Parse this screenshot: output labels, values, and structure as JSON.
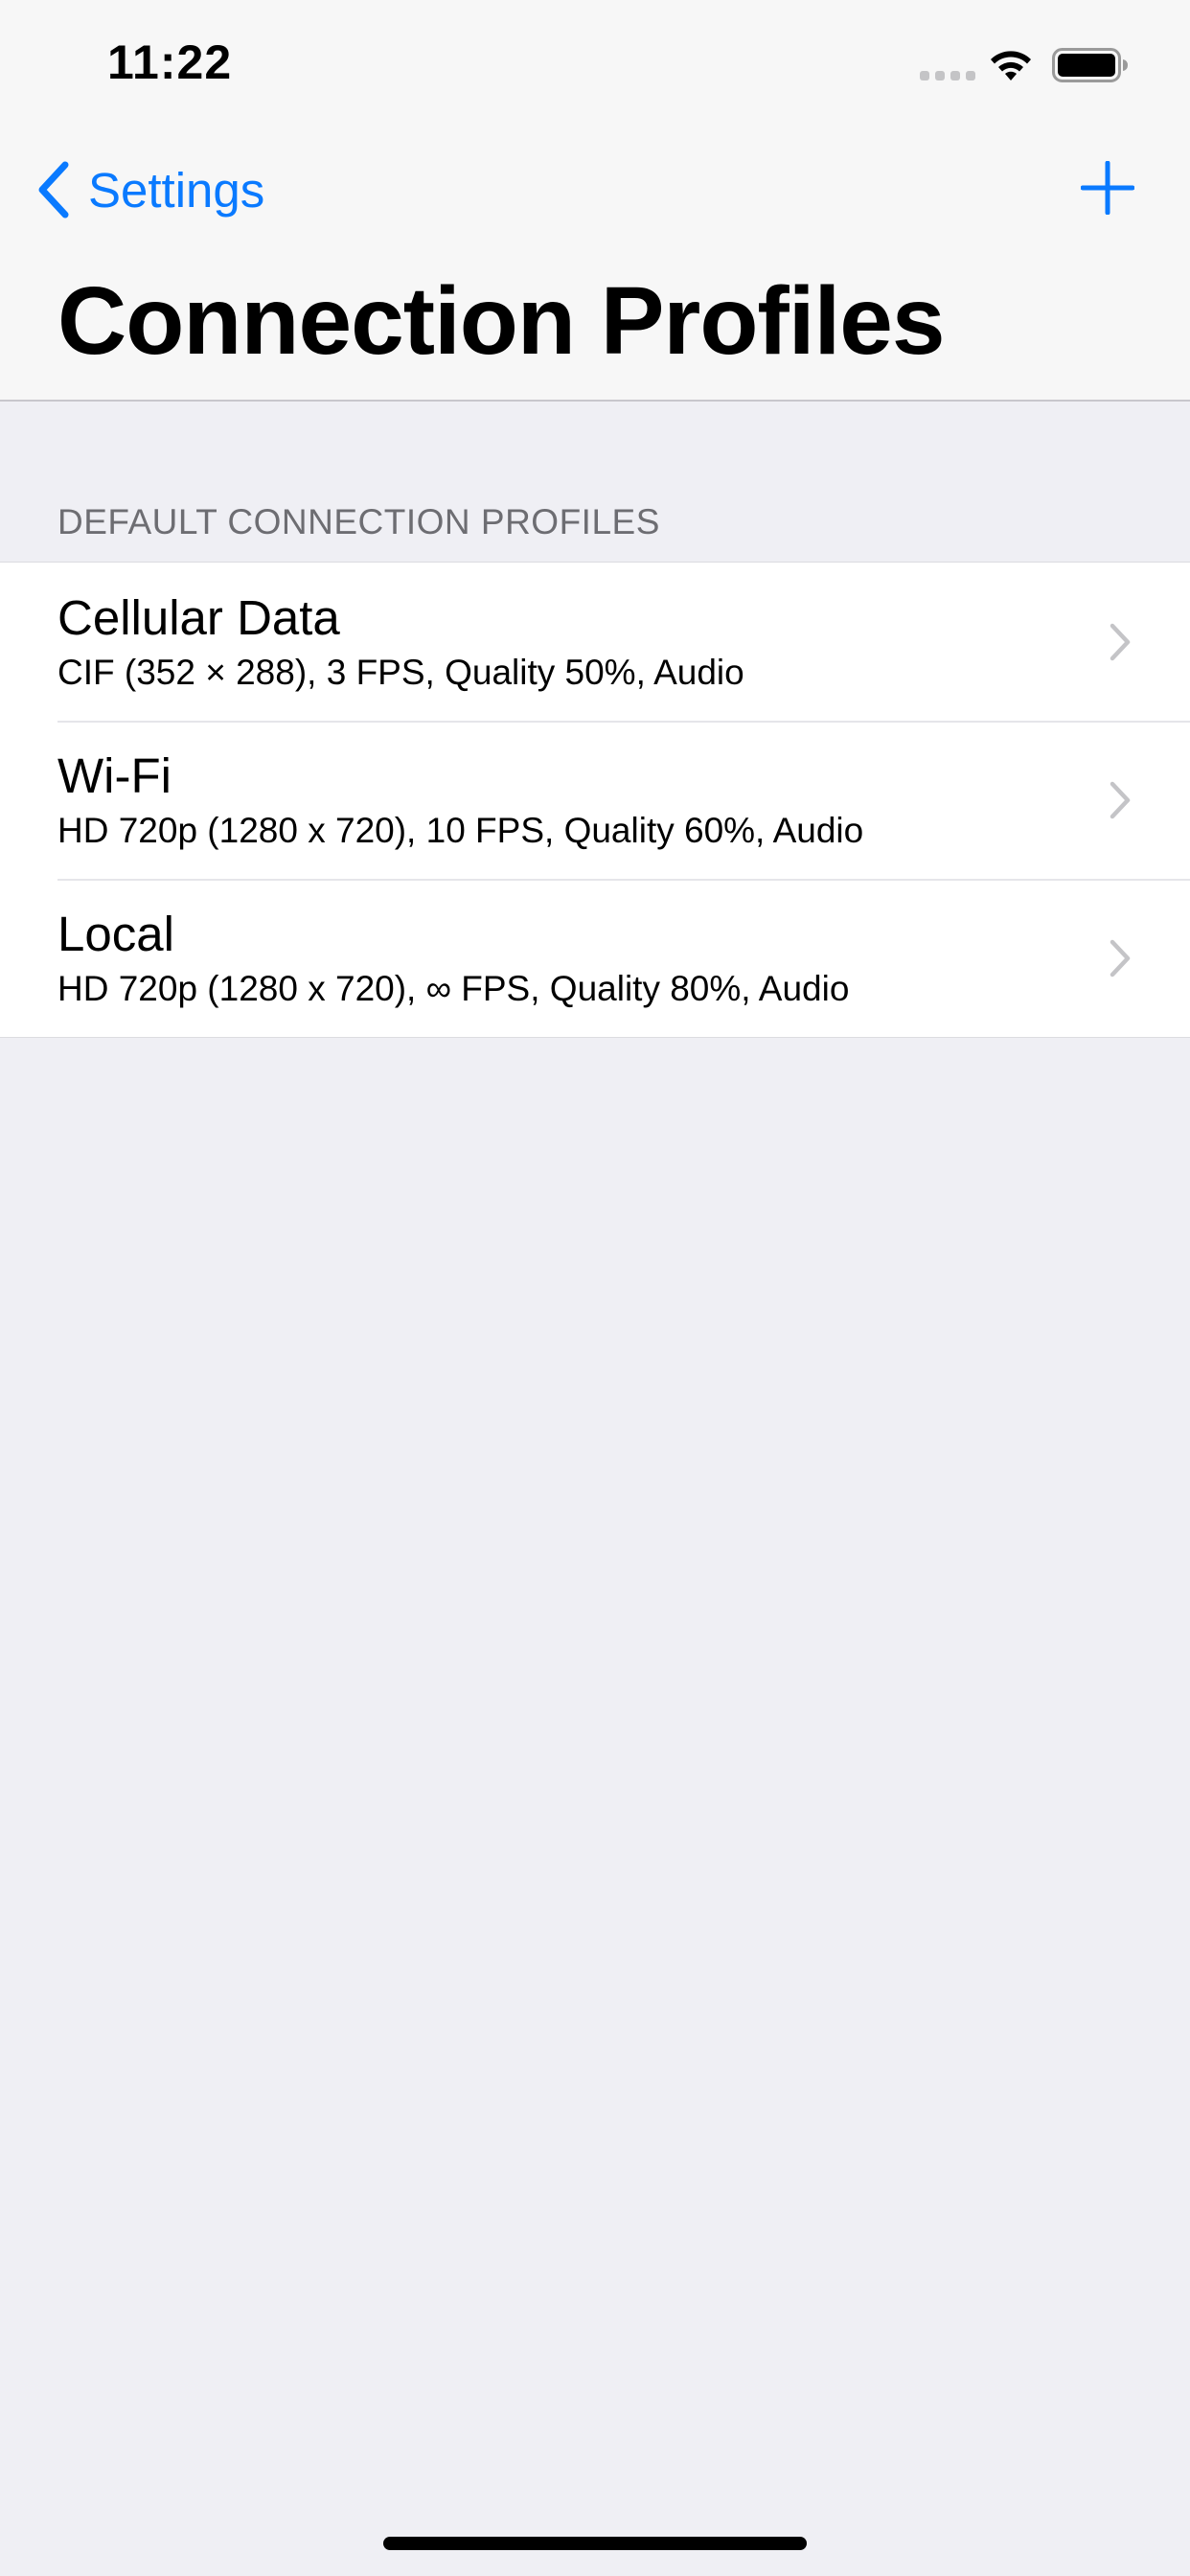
{
  "status_bar": {
    "time": "11:22"
  },
  "nav": {
    "back_label": "Settings",
    "title": "Connection Profiles",
    "add_icon": "plus-icon"
  },
  "section": {
    "header": "DEFAULT CONNECTION PROFILES",
    "items": [
      {
        "title": "Cellular Data",
        "subtitle": "CIF (352 × 288), 3 FPS, Quality 50%, Audio"
      },
      {
        "title": "Wi-Fi",
        "subtitle": "HD 720p (1280 x 720), 10 FPS, Quality 60%, Audio"
      },
      {
        "title": "Local",
        "subtitle": "HD 720p (1280 x 720), ∞ FPS, Quality 80%, Audio"
      }
    ]
  },
  "colors": {
    "accent": "#0a7aff",
    "background": "#efeff4",
    "section_header": "#6d6d72",
    "chevron": "#c4c4c7"
  }
}
